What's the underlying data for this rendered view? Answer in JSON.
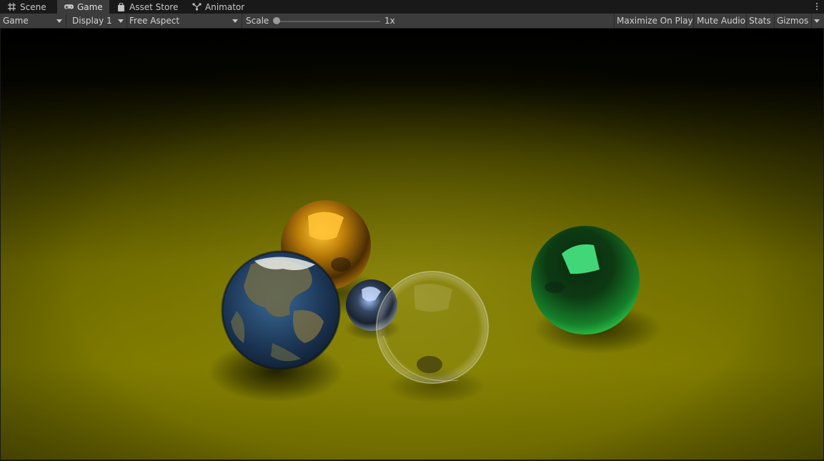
{
  "tabs": [
    {
      "label": "Scene",
      "icon": "grid-icon",
      "active": false
    },
    {
      "label": "Game",
      "icon": "gamepad-icon",
      "active": true
    },
    {
      "label": "Asset Store",
      "icon": "shopping-bag-icon",
      "active": false
    },
    {
      "label": "Animator",
      "icon": "animator-icon",
      "active": false
    }
  ],
  "toolbar": {
    "view_mode": "Game",
    "display": "Display 1",
    "aspect": "Free Aspect",
    "scale_label": "Scale",
    "scale_value": "1x",
    "scale_slider_fraction": 0,
    "maximize_on_play": "Maximize On Play",
    "mute_audio": "Mute Audio",
    "stats": "Stats",
    "gizmos": "Gizmos"
  },
  "colors": {
    "panel_bg": "#191919",
    "toolbar_bg": "#3c3c3c",
    "active_tab_bg": "#3c3c3c",
    "floor": "#8a8600",
    "gold_sphere": "#c8860c",
    "green_sphere": "#1fb33a",
    "chrome_sphere": "#6f7c88",
    "earth_ocean": "#24446a"
  }
}
